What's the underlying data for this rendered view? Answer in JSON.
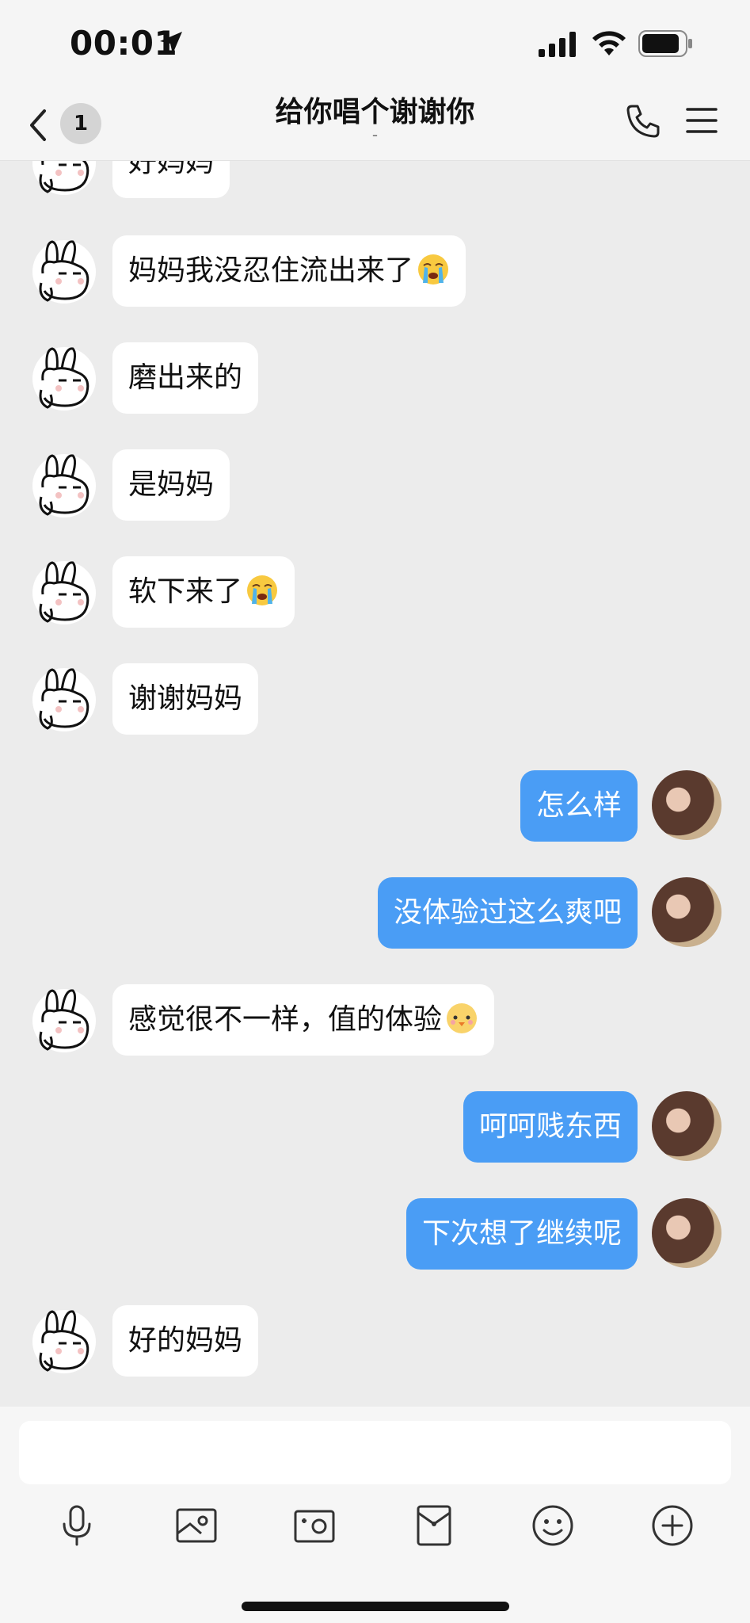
{
  "status_bar": {
    "time": "00:01"
  },
  "header": {
    "back_count": "1",
    "title": "给你唱个谢谢你",
    "subtitle": "-"
  },
  "messages": [
    {
      "side": "in",
      "text": "好妈妈"
    },
    {
      "side": "in",
      "text": "妈妈我没忍住流出来了",
      "emoji": "crying-face"
    },
    {
      "side": "in",
      "text": "磨出来的"
    },
    {
      "side": "in",
      "text": "是妈妈"
    },
    {
      "side": "in",
      "text": "软下来了",
      "emoji": "crying-face"
    },
    {
      "side": "in",
      "text": "谢谢妈妈"
    },
    {
      "side": "out",
      "text": "怎么样"
    },
    {
      "side": "out",
      "text": "没体验过这么爽吧"
    },
    {
      "side": "in",
      "text": "感觉很不一样，值的体验",
      "emoji": "chick-face"
    },
    {
      "side": "out",
      "text": "呵呵贱东西"
    },
    {
      "side": "out",
      "text": "下次想了继续呢"
    },
    {
      "side": "in",
      "text": "好的妈妈"
    }
  ],
  "input": {
    "placeholder": ""
  },
  "toolbar": [
    "mic-icon",
    "photo-icon",
    "camera-icon",
    "red-packet-icon",
    "emoji-icon",
    "plus-icon"
  ],
  "colors": {
    "outgoing_bubble": "#4a9df5",
    "incoming_bubble": "#ffffff",
    "background": "#ececec"
  }
}
